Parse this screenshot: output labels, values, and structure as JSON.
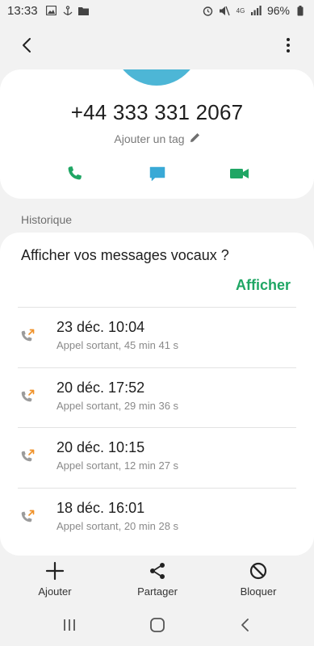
{
  "status_bar": {
    "time": "13:33",
    "network": "4G",
    "battery": "96%"
  },
  "contact": {
    "phone_number": "+44 333 331 2067",
    "tag_label": "Ajouter un tag"
  },
  "history": {
    "section_label": "Historique",
    "voicemail_question": "Afficher vos messages vocaux ?",
    "voicemail_action": "Afficher",
    "calls": [
      {
        "datetime": "23 déc. 10:04",
        "detail": "Appel sortant, 45 min 41 s"
      },
      {
        "datetime": "20 déc. 17:52",
        "detail": "Appel sortant, 29 min 36 s"
      },
      {
        "datetime": "20 déc. 10:15",
        "detail": "Appel sortant, 12 min 27 s"
      },
      {
        "datetime": "18 déc. 16:01",
        "detail": "Appel sortant, 20 min 28 s"
      }
    ]
  },
  "bottom_actions": {
    "add": "Ajouter",
    "share": "Partager",
    "block": "Bloquer"
  },
  "colors": {
    "accent_green": "#1fa664",
    "avatar": "#4db6d6",
    "message_blue": "#39a9d6",
    "outgoing_arrow": "#f0922a"
  }
}
